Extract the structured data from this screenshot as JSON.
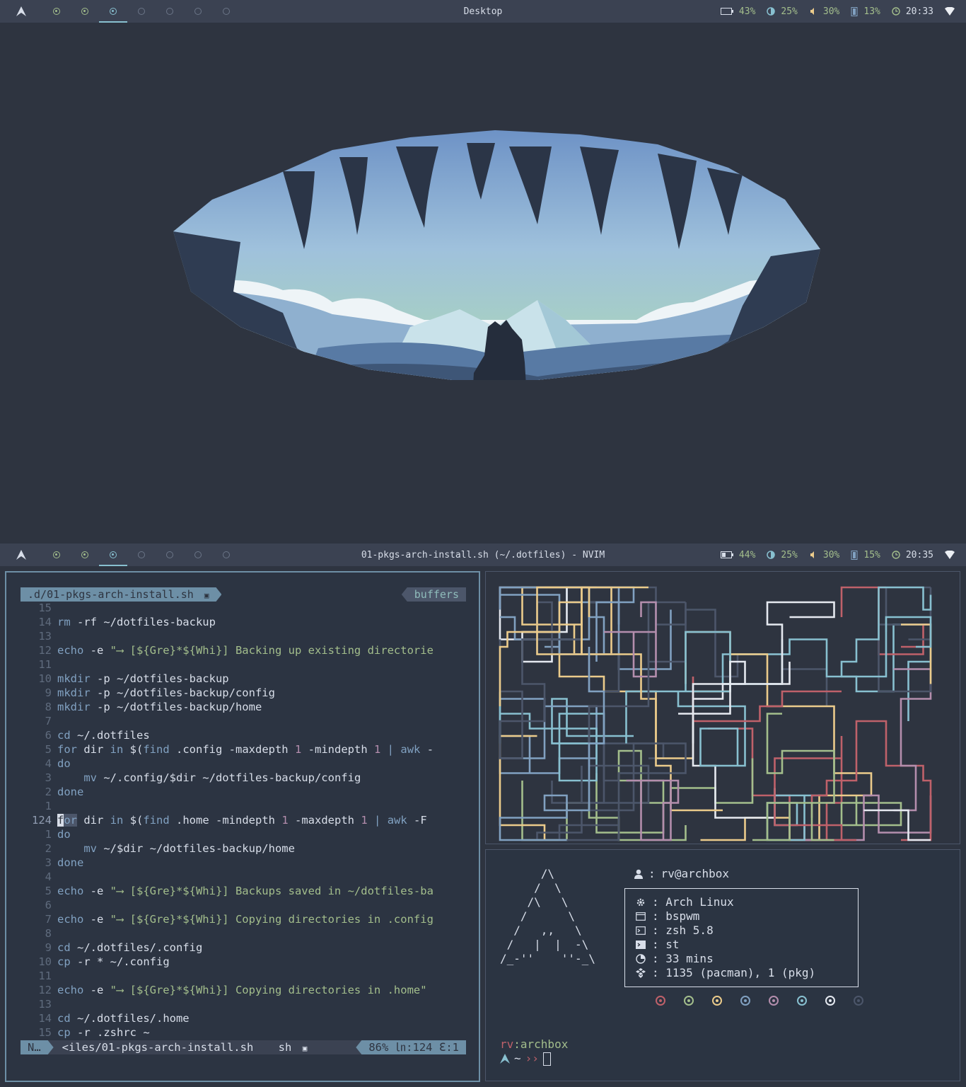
{
  "top_bar": {
    "title": "Desktop",
    "battery": "43%",
    "brightness": "25%",
    "volume": "30%",
    "memory": "13%",
    "clock": "20:33"
  },
  "bottom_bar": {
    "title": "01-pkgs-arch-install.sh (~/.dotfiles) - NVIM",
    "battery": "44%",
    "brightness": "25%",
    "volume": "30%",
    "memory": "15%",
    "clock": "20:35"
  },
  "workspaces": [
    {
      "state": "occupied",
      "color": "#a3be8c"
    },
    {
      "state": "occupied",
      "color": "#a3be8c"
    },
    {
      "state": "active",
      "color": "#88c0d0"
    },
    {
      "state": "empty",
      "color": "#6b7587"
    },
    {
      "state": "empty",
      "color": "#6b7587"
    },
    {
      "state": "empty",
      "color": "#6b7587"
    },
    {
      "state": "empty",
      "color": "#6b7587"
    }
  ],
  "nvim": {
    "tab_file": ".d/01-pkgs-arch-install.sh",
    "tab_buffers": "buffers",
    "status_mode": "N…",
    "status_file": "<iles/01-pkgs-arch-install.sh",
    "status_filetype": "sh",
    "status_position": "86% ㏑:124 ℇ:1",
    "lines": [
      {
        "n": "15",
        "t": ""
      },
      {
        "n": "14",
        "t": "rm -rf ~/dotfiles-backup"
      },
      {
        "n": "13",
        "t": ""
      },
      {
        "n": "12",
        "t": "echo -e \"⟶ [${Gre}*${Whi}] Backing up existing directorie"
      },
      {
        "n": "11",
        "t": ""
      },
      {
        "n": "10",
        "t": "mkdir -p ~/dotfiles-backup"
      },
      {
        "n": "9",
        "t": "mkdir -p ~/dotfiles-backup/config"
      },
      {
        "n": "8",
        "t": "mkdir -p ~/dotfiles-backup/home"
      },
      {
        "n": "7",
        "t": ""
      },
      {
        "n": "6",
        "t": "cd ~/.dotfiles"
      },
      {
        "n": "5",
        "t": "for dir in $(find .config -maxdepth 1 -mindepth 1 | awk -"
      },
      {
        "n": "4",
        "t": "do"
      },
      {
        "n": "3",
        "t": "    mv ~/.config/$dir ~/dotfiles-backup/config"
      },
      {
        "n": "2",
        "t": "done"
      },
      {
        "n": "1",
        "t": ""
      },
      {
        "n": "124",
        "t": "for dir in $(find .home -mindepth 1 -maxdepth 1 | awk -F"
      },
      {
        "n": "1",
        "t": "do"
      },
      {
        "n": "2",
        "t": "    mv ~/$dir ~/dotfiles-backup/home"
      },
      {
        "n": "3",
        "t": "done"
      },
      {
        "n": "4",
        "t": ""
      },
      {
        "n": "5",
        "t": "echo -e \"⟶ [${Gre}*${Whi}] Backups saved in ~/dotfiles-ba"
      },
      {
        "n": "6",
        "t": ""
      },
      {
        "n": "7",
        "t": "echo -e \"⟶ [${Gre}*${Whi}] Copying directories in .config"
      },
      {
        "n": "8",
        "t": ""
      },
      {
        "n": "9",
        "t": "cd ~/.dotfiles/.config"
      },
      {
        "n": "10",
        "t": "cp -r * ~/.config"
      },
      {
        "n": "11",
        "t": ""
      },
      {
        "n": "12",
        "t": "echo -e \"⟶ [${Gre}*${Whi}] Copying directories in .home\""
      },
      {
        "n": "13",
        "t": ""
      },
      {
        "n": "14",
        "t": "cd ~/.dotfiles/.home"
      },
      {
        "n": "15",
        "t": "cp -r .zshrc ~"
      }
    ]
  },
  "fetch": {
    "ascii": "      /\\\n     /  \\\n    /\\   \\\n   /      \\\n  /   ,,   \\\n /   |  |  -\\\n/_-''    ''-_\\",
    "user": "rv@archbox",
    "rows": [
      {
        "icon": "gear-icon",
        "text": ": Arch Linux"
      },
      {
        "icon": "window-icon",
        "text": ": bspwm"
      },
      {
        "icon": "terminal-icon",
        "text": ": zsh 5.8"
      },
      {
        "icon": "console-icon",
        "text": ": st"
      },
      {
        "icon": "uptime-icon",
        "text": ": 33 mins"
      },
      {
        "icon": "package-icon",
        "text": ": 1135 (pacman), 1 (pkg)"
      }
    ],
    "palette": [
      "#bf616a",
      "#a3be8c",
      "#ebcb8b",
      "#81a1c1",
      "#b48ead",
      "#88c0d0",
      "#e5e9f0",
      "#4c566a"
    ],
    "prompt_user": "rv",
    "prompt_host": ":archbox",
    "prompt_dir": "~",
    "prompt_arrows": "››"
  }
}
